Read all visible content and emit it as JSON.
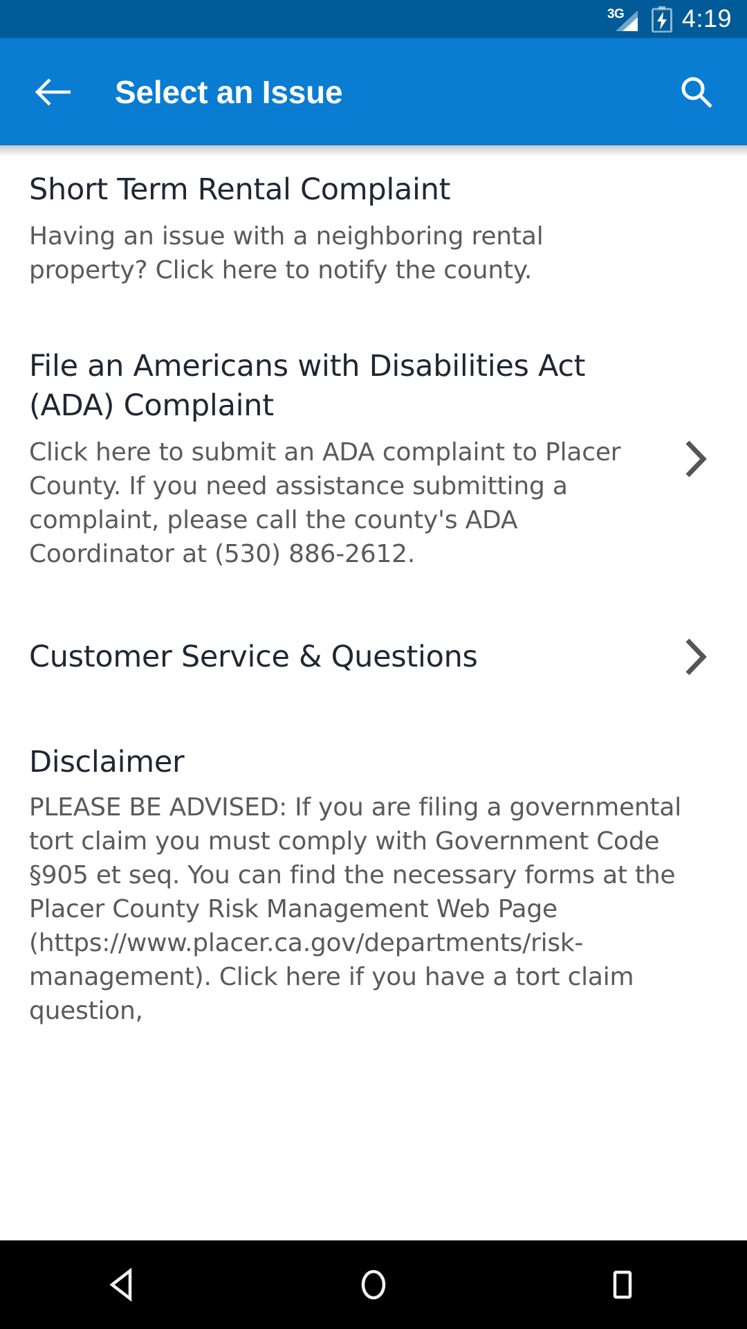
{
  "status_bar": {
    "network_label": "3G",
    "time": "4:19",
    "signal_icon": "signal-3g-icon",
    "battery_icon": "battery-charging-icon",
    "background_color": "#015b98"
  },
  "app_bar": {
    "title": "Select an Issue",
    "back_icon": "arrow-left-icon",
    "search_icon": "search-icon",
    "background_color": "#0a7cd1",
    "text_color": "#ffffff"
  },
  "items": [
    {
      "title": "Short Term Rental Complaint",
      "description": "Having an issue with a neighboring rental property? Click here to notify the county.",
      "has_chevron": false
    },
    {
      "title": "File an Americans with Disabilities Act (ADA) Complaint",
      "description": "Click here to submit an ADA complaint to Placer County. If you need assistance submitting a complaint, please call the county's ADA Coordinator at (530) 886-2612.",
      "has_chevron": true
    },
    {
      "title": "Customer Service & Questions",
      "description": "",
      "has_chevron": true
    }
  ],
  "disclaimer": {
    "title": "Disclaimer",
    "body": "PLEASE BE ADVISED:  If you are filing a governmental tort claim you must comply with Government Code §905 et seq.  You can find the necessary forms at the Placer County Risk Management Web Page (https://www.placer.ca.gov/departments/risk-management). Click here if you have a tort claim question,"
  },
  "nav_bar": {
    "back_icon": "nav-back-triangle-icon",
    "home_icon": "nav-home-circle-icon",
    "recents_icon": "nav-recents-square-icon",
    "background_color": "#000000"
  },
  "colors": {
    "title_text": "#1f2733",
    "body_text": "#5a5a5a",
    "chevron": "#555555"
  }
}
